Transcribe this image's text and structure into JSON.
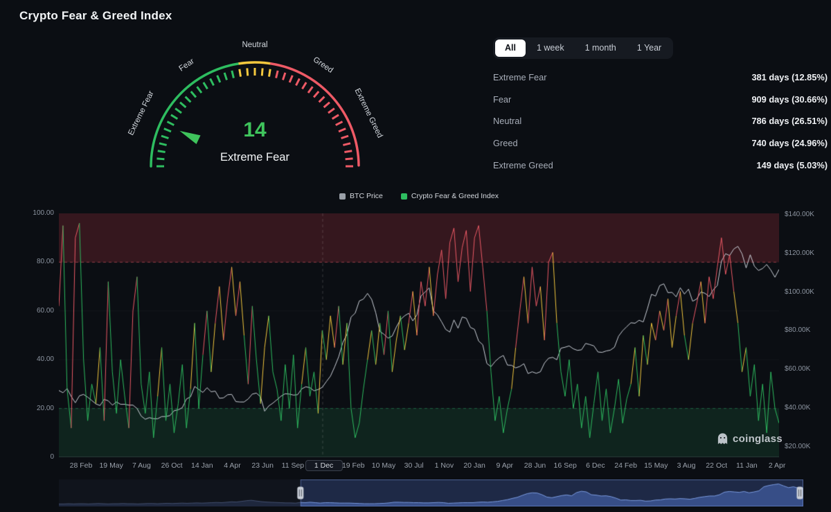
{
  "page": {
    "title": "Crypto Fear & Greed Index"
  },
  "colors": {
    "bg": "#0b0e13",
    "green": "#2ebd60",
    "yellow": "#f3c83e",
    "red": "#ee5a66",
    "value_green": "#3fc45c",
    "btc_line": "#ccd1d9",
    "band_red": "rgba(225,60,75,0.20)",
    "band_green": "rgba(46,189,110,0.13)",
    "btc_swatch": "#9aa0a8",
    "nav_line": "#7b9be0",
    "nav_fill": "rgba(80,115,200,0.5)",
    "nav_dim_fill": "rgba(70,95,160,0.25)",
    "nav_sel_bg": "rgba(64,94,170,0.30)"
  },
  "gauge": {
    "value": "14",
    "classification": "Extreme Fear",
    "scale_labels": [
      "Extreme Fear",
      "Fear",
      "Neutral",
      "Greed",
      "Extreme Greed"
    ]
  },
  "range_tabs": [
    {
      "label": "All",
      "active": true
    },
    {
      "label": "1 week",
      "active": false
    },
    {
      "label": "1 month",
      "active": false
    },
    {
      "label": "1 Year",
      "active": false
    }
  ],
  "stats": [
    {
      "label": "Extreme Fear",
      "value": "381 days (12.85%)"
    },
    {
      "label": "Fear",
      "value": "909 days (30.66%)"
    },
    {
      "label": "Neutral",
      "value": "786 days (26.51%)"
    },
    {
      "label": "Greed",
      "value": "740 days (24.96%)"
    },
    {
      "label": "Extreme Greed",
      "value": "149 days (5.03%)"
    }
  ],
  "legend": [
    {
      "label": "BTC Price",
      "color": "#9aa0a8"
    },
    {
      "label": "Crypto Fear & Greed Index",
      "color": "#2ebd60"
    }
  ],
  "watermark": {
    "text": "coinglass"
  },
  "chart_data": {
    "type": "line",
    "title": "Crypto Fear & Greed Index vs BTC Price",
    "legend": [
      "BTC Price",
      "Crypto Fear & Greed Index"
    ],
    "left_axis": {
      "ticks": [
        "100.00",
        "80.00",
        "60.00",
        "40.00",
        "20.00",
        "0"
      ],
      "range": [
        0,
        100
      ]
    },
    "right_axis": {
      "ticks": [
        "$140.00K",
        "$120.00K",
        "$100.00K",
        "$80.00K",
        "$60.00K",
        "$40.00K",
        "$20.00K"
      ]
    },
    "x_labels": [
      "28 Feb",
      "19 May",
      "7 Aug",
      "26 Oct",
      "14 Jan",
      "4 Apr",
      "23 Jun",
      "11 Sep",
      "1 Dec",
      "19 Feb",
      "10 May",
      "30 Jul",
      "1 Nov",
      "20 Jan",
      "9 Apr",
      "28 Jun",
      "16 Sep",
      "6 Dec",
      "24 Feb",
      "15 May",
      "3 Aug",
      "22 Oct",
      "11 Jan",
      "2 Apr"
    ],
    "x_highlight": "1 Dec",
    "bands": [
      {
        "range": [
          80,
          100
        ],
        "meaning": "extreme greed zone",
        "color": "rgba(225,60,75,0.20)"
      },
      {
        "range": [
          0,
          20
        ],
        "meaning": "extreme fear zone",
        "color": "rgba(46,189,110,0.13)"
      }
    ],
    "series": [
      {
        "name": "Crypto Fear & Greed Index",
        "axis": "left",
        "color_rule": {
          "green": "<45",
          "yellow": "45-58",
          "red": ">58"
        },
        "values": [
          62,
          95,
          28,
          12,
          90,
          96,
          40,
          15,
          30,
          22,
          45,
          15,
          72,
          35,
          18,
          40,
          25,
          12,
          60,
          74,
          30,
          18,
          35,
          8,
          25,
          45,
          15,
          30,
          10,
          22,
          38,
          12,
          28,
          55,
          20,
          42,
          60,
          35,
          55,
          70,
          48,
          65,
          78,
          58,
          72,
          50,
          30,
          62,
          40,
          22,
          45,
          58,
          35,
          28,
          15,
          38,
          20,
          42,
          12,
          30,
          45,
          25,
          35,
          18,
          52,
          40,
          58,
          45,
          62,
          38,
          55,
          20,
          8,
          14,
          28,
          40,
          52,
          38,
          55,
          42,
          60,
          35,
          48,
          58,
          44,
          55,
          68,
          50,
          72,
          62,
          78,
          58,
          75,
          85,
          65,
          88,
          94,
          72,
          86,
          93,
          68,
          90,
          95,
          78,
          60,
          35,
          15,
          25,
          10,
          20,
          28,
          45,
          60,
          74,
          55,
          78,
          62,
          70,
          48,
          80,
          84,
          55,
          35,
          25,
          40,
          20,
          30,
          12,
          25,
          8,
          22,
          35,
          15,
          28,
          10,
          20,
          32,
          14,
          24,
          30,
          45,
          25,
          50,
          38,
          55,
          48,
          60,
          52,
          65,
          45,
          58,
          68,
          50,
          40,
          55,
          63,
          72,
          55,
          74,
          65,
          78,
          90,
          75,
          83,
          68,
          55,
          35,
          45,
          25,
          38,
          15,
          30,
          10,
          35,
          20,
          14
        ]
      },
      {
        "name": "BTC Price",
        "axis": "right",
        "unit": "$K",
        "values": [
          10.5,
          9.8,
          11.1,
          8.7,
          7.0,
          8.9,
          9.3,
          8.5,
          7.6,
          6.7,
          6.3,
          7.9,
          7.5,
          6.4,
          7.2,
          6.6,
          6.6,
          6.4,
          6.4,
          5.6,
          4.0,
          3.4,
          3.7,
          3.5,
          3.5,
          3.9,
          3.9,
          4.1,
          5.1,
          5.3,
          5.8,
          8.0,
          8.6,
          11.8,
          10.8,
          9.9,
          11.4,
          10.1,
          10.3,
          8.2,
          8.3,
          9.2,
          9.3,
          7.3,
          7.2,
          7.2,
          8.0,
          9.4,
          9.7,
          8.6,
          5.0,
          6.2,
          6.9,
          7.8,
          8.8,
          9.5,
          9.4,
          9.1,
          9.2,
          11.0,
          11.7,
          11.4,
          10.4,
          10.8,
          11.5,
          13.5,
          15.5,
          19.2,
          23.8,
          31.0,
          35.5,
          46.3,
          48.9,
          57.5,
          58.9,
          63.2,
          58.7,
          49.2,
          37.3,
          35.6,
          33.4,
          34.6,
          39.9,
          44.6,
          47.1,
          48.8,
          43.8,
          47.7,
          61.3,
          64.3,
          67.5,
          50.5,
          47.7,
          43.2,
          38.5,
          36.9,
          44.4,
          39.2,
          46.3,
          45.5,
          39.7,
          38.5,
          31.8,
          29.8,
          20.7,
          19.3,
          21.6,
          23.3,
          24.4,
          20.0,
          19.9,
          18.8,
          19.4,
          20.6,
          16.5,
          17.2,
          16.6,
          17.2,
          20.9,
          23.1,
          23.5,
          22.4,
          28.0,
          28.5,
          29.2,
          27.7,
          26.9,
          27.2,
          30.5,
          29.9,
          29.2,
          26.1,
          25.9,
          26.6,
          27.0,
          28.5,
          34.5,
          37.7,
          40.2,
          42.6,
          42.3,
          44.2,
          43.1,
          51.8,
          62.5,
          61.2,
          69.4,
          70.8,
          63.8,
          64.0,
          60.6,
          67.6,
          62.7,
          66.5,
          57.3,
          59.0,
          64.3,
          63.3,
          60.8,
          66.0,
          69.4,
          90.5,
          97.5,
          95.8,
          102.1,
          104.7,
          97.5,
          84.4,
          96.5,
          86.0,
          82.1,
          83.9,
          87.5,
          82.5,
          76.3,
          83.0
        ]
      }
    ],
    "navigator": {
      "selection_start_index": 49,
      "values": [
        2,
        2,
        3,
        2,
        3,
        3,
        2,
        3,
        4,
        3,
        2,
        3,
        3,
        4,
        3,
        3,
        2,
        3,
        4,
        4,
        3,
        4,
        5,
        4,
        5,
        6,
        5,
        6,
        7,
        6,
        7,
        8,
        9,
        8,
        10,
        12,
        11,
        14,
        17,
        19,
        16,
        13,
        11,
        10,
        9,
        8,
        7,
        7,
        6,
        9,
        8,
        10,
        8,
        6,
        8,
        8,
        7,
        6,
        6,
        6,
        5,
        4,
        3,
        3,
        3,
        4,
        5,
        7,
        10,
        10,
        9,
        9,
        8,
        8,
        7,
        7,
        8,
        9,
        8,
        5,
        6,
        7,
        8,
        8,
        8,
        10,
        11,
        10,
        12,
        14,
        18,
        22,
        28,
        33,
        42,
        50,
        54,
        53,
        45,
        34,
        31,
        36,
        41,
        44,
        40,
        55,
        61,
        58,
        45,
        43,
        39,
        40,
        36,
        29,
        20,
        21,
        18,
        18,
        19,
        15,
        16,
        20,
        21,
        25,
        26,
        25,
        27,
        26,
        24,
        28,
        33,
        36,
        39,
        39,
        45,
        57,
        60,
        58,
        56,
        60,
        54,
        58,
        63,
        82,
        88,
        92,
        95,
        86,
        78,
        82,
        76,
        75
      ]
    }
  }
}
